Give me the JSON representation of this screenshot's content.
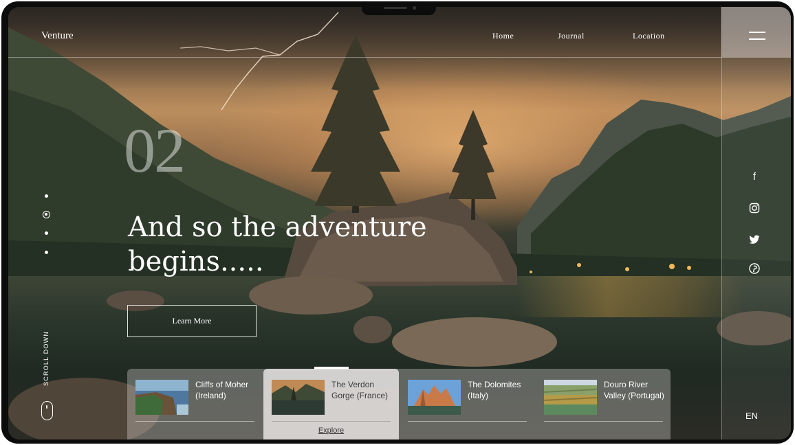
{
  "header": {
    "brand": "Venture",
    "nav": [
      "Home",
      "Journal",
      "Location"
    ]
  },
  "menu": {
    "icon": "hamburger-menu-icon"
  },
  "hero": {
    "slide_number": "02",
    "headline_line1": "And so the adventure",
    "headline_line2": "begins.....",
    "cta_label": "Learn More"
  },
  "sidebar_left": {
    "scroll_label": "SCROLL DOWN",
    "active_dot": 2,
    "dot_count": 4
  },
  "social": [
    {
      "name": "facebook-icon",
      "glyph": "f"
    },
    {
      "name": "instagram-icon",
      "glyph": "◎"
    },
    {
      "name": "twitter-icon",
      "glyph": "🐦"
    },
    {
      "name": "pinterest-icon",
      "glyph": "p"
    }
  ],
  "language": "EN",
  "destinations": [
    {
      "title": "Cliffs of Moher (Ireland)",
      "active": false
    },
    {
      "title": "The Verdon Gorge (France)",
      "active": true,
      "action": "Explore"
    },
    {
      "title": "The Dolomites (Italy)",
      "active": false
    },
    {
      "title": "Douro River Valley (Portugal)",
      "active": false
    }
  ],
  "colors": {
    "accent_white": "#ffffff",
    "sky_glow": "#d8965c",
    "active_card": "#ece8e6"
  }
}
